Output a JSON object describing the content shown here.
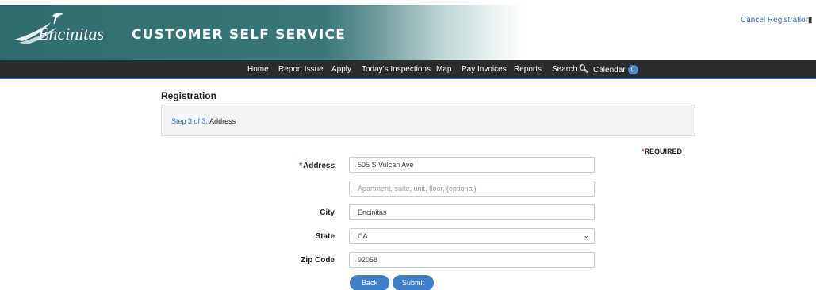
{
  "header": {
    "logo_text": "Encinitas",
    "site_title": "CUSTOMER SELF SERVICE",
    "cancel_link": "Cancel Registration",
    "cancel_icon": "exit-icon"
  },
  "nav": {
    "items": [
      "Home",
      "Report Issue",
      "Apply",
      "Today's Inspections",
      "Map",
      "Pay Invoices",
      "Reports",
      "Search",
      "Calendar"
    ],
    "calendar_badge": "0",
    "search_icon": "search-icon"
  },
  "page": {
    "title": "Registration",
    "step_prefix": "Step 3 of 3:",
    "step_name": "Address",
    "required_note": "REQUIRED",
    "required_star": "*"
  },
  "form": {
    "address_label": "Address",
    "address_value": "505 S Vulcan Ave",
    "address2_placeholder": "Apartment, suite, unit, floor, (optional)",
    "city_label": "City",
    "city_value": "Encinitas",
    "state_label": "State",
    "state_value": "CA",
    "zip_label": "Zip Code",
    "zip_value": "92058"
  },
  "buttons": {
    "back": "Back",
    "submit": "Submit"
  },
  "colors": {
    "banner_teal": "#2f6d6d",
    "navbar_bg": "#2c2c2c",
    "accent_blue": "#3f7fca",
    "required_red": "#c0392b"
  }
}
